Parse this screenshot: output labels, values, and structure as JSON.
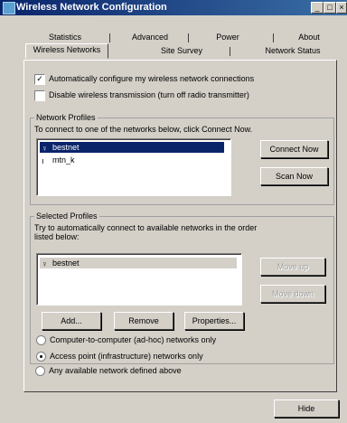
{
  "window": {
    "title": "Wireless Network Configuration",
    "minimize": "_",
    "maximize": "□",
    "close": "×"
  },
  "tabs_back": [
    "Statistics",
    "Advanced",
    "Power",
    "About"
  ],
  "tabs_front": [
    "Wireless Networks",
    "Site Survey",
    "Network Status"
  ],
  "options": {
    "auto_configure": "Automatically configure my wireless network connections",
    "disable_transmission": "Disable wireless transmission (turn off radio transmitter)"
  },
  "network_profiles": {
    "group_label": "Network Profiles",
    "instruction": "To connect to one of the networks below, click Connect Now.",
    "items": [
      "bestnet",
      "mtn_k"
    ],
    "connect_now": "Connect Now",
    "scan_now": "Scan Now"
  },
  "selected_profiles": {
    "group_label": "Selected Profiles",
    "instruction_line1": "Try to automatically connect to available networks in the order",
    "instruction_line2": "listed below:",
    "items": [
      "bestnet"
    ],
    "move_up": "Move up",
    "move_down": "Move down",
    "add": "Add...",
    "remove": "Remove",
    "properties": "Properties..."
  },
  "network_modes": {
    "adhoc": "Computer-to-computer (ad-hoc) networks only",
    "infrastructure": "Access point (infrastructure) networks only",
    "any": "Any available network defined above",
    "selected": "infrastructure"
  },
  "footer": {
    "hide": "Hide"
  }
}
